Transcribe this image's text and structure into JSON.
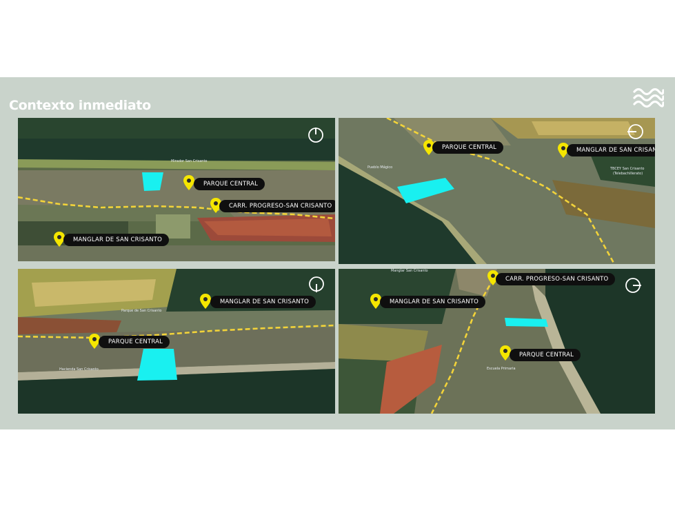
{
  "title": "Contexto inmediato",
  "logo_icon": "waves-icon",
  "colors": {
    "background": "#c9d3cb",
    "pin": "#f5e600",
    "plot": "#19f0f0",
    "road": "#f2d33a",
    "label_bg": "#0f0f0f"
  },
  "labels": {
    "parque_central": "PARQUE CENTRAL",
    "carretera": "CARR. PROGRESO-SAN CRISANTO",
    "manglar": "MANGLAR DE SAN CRISANTO"
  },
  "map_text": {
    "p1_town": "Mirador San Crisanto",
    "p2_tbcey": "TBCEY San Crisanto",
    "p2_tele": "(Telebachillerato)",
    "p2_misc": "Pueblo Mágico",
    "p3_misc": "Parque de San Crisanto",
    "p3_misc2": "Hacienda San Crisanto",
    "p4_top": "Manglar San Crisanto",
    "p4_misc": "Escuela Primaria"
  },
  "compass_icons": [
    "compass-north-icon",
    "compass-east-icon",
    "compass-south-icon",
    "compass-west-icon"
  ]
}
